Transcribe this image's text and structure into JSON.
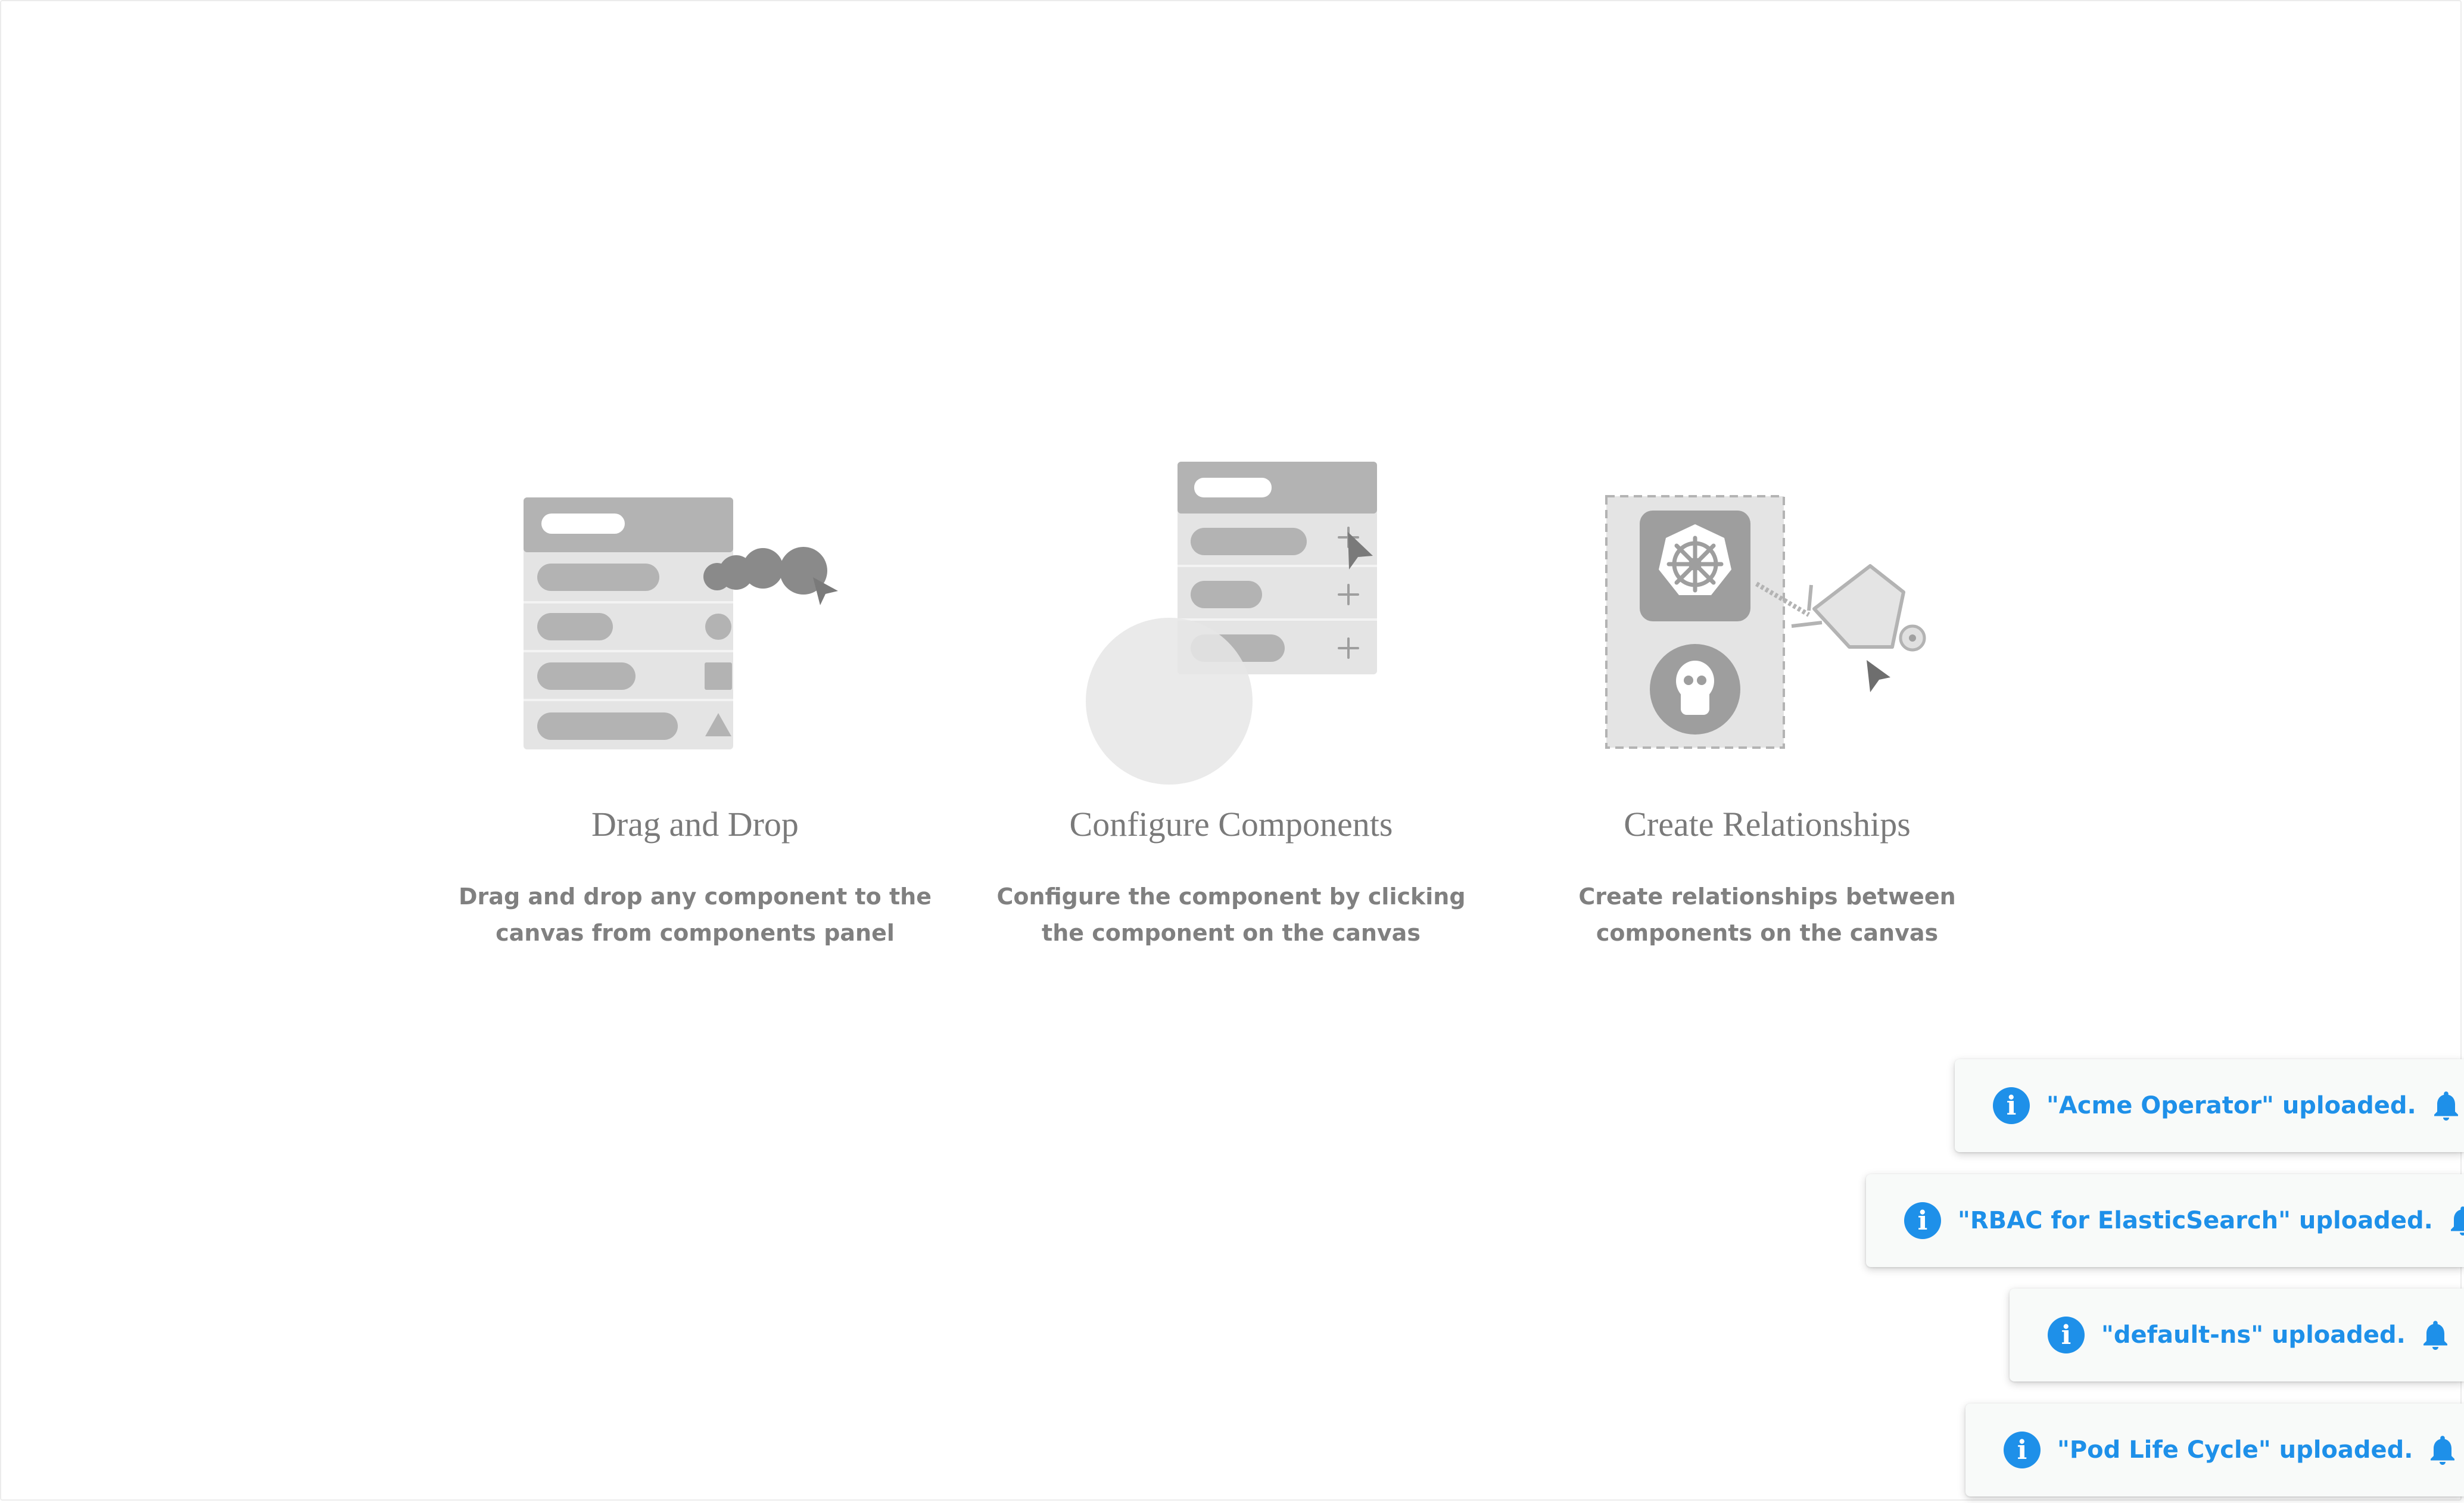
{
  "onboarding": {
    "cards": [
      {
        "title": "Drag and Drop",
        "description": "Drag and drop any component to the\ncanvas from components panel"
      },
      {
        "title": "Configure Components",
        "description": "Configure the component by clicking\nthe component on the canvas"
      },
      {
        "title": "Create Relationships",
        "description": "Create relationships between\ncomponents on the canvas"
      }
    ]
  },
  "notifications": [
    {
      "message": "\"Acme Operator\" uploaded.",
      "icon": "info-icon",
      "action_icon": "bell-icon"
    },
    {
      "message": "\"RBAC for ElasticSearch\" uploaded.",
      "icon": "info-icon",
      "action_icon": "bell-icon"
    },
    {
      "message": "\"default-ns\" uploaded.",
      "icon": "info-icon",
      "action_icon": "bell-icon"
    },
    {
      "message": "\"Pod Life Cycle\" uploaded.",
      "icon": "info-icon",
      "action_icon": "bell-icon"
    }
  ],
  "colors": {
    "accent": "#1e90e9",
    "illustration_gray": "#b3b3b3",
    "text_gray": "#808080"
  }
}
